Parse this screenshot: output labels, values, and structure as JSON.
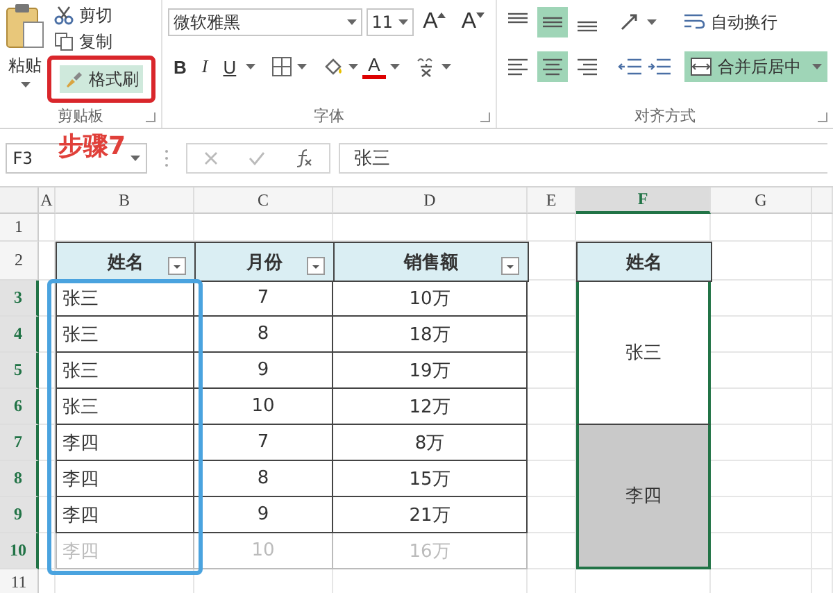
{
  "ribbon": {
    "clipboard": {
      "paste": "粘贴",
      "cut": "剪切",
      "copy": "复制",
      "format_painter": {
        "label": "格式刷",
        "selected": true
      },
      "label": "剪贴板"
    },
    "font": {
      "font_name": "微软雅黑",
      "font_size": "11",
      "bold": "B",
      "italic": "I",
      "underline": "U",
      "font_color": "A",
      "grow": "A",
      "shrink": "A",
      "label": "字体"
    },
    "alignment": {
      "vertical": [
        {
          "kind": "top",
          "selected": false
        },
        {
          "kind": "middle",
          "selected": true
        },
        {
          "kind": "bottom",
          "selected": false
        }
      ],
      "horizontal": [
        {
          "kind": "left",
          "selected": false
        },
        {
          "kind": "center",
          "selected": true
        },
        {
          "kind": "right",
          "selected": false
        }
      ],
      "wrap_text": "自动换行",
      "merge": {
        "label": "合并后居中",
        "selected": true
      },
      "label": "对齐方式"
    }
  },
  "annotation": "步骤7",
  "formula_bar": {
    "name_box": "F3",
    "value": "张三"
  },
  "columns": [
    {
      "label": "A",
      "selected": false
    },
    {
      "label": "B",
      "selected": false
    },
    {
      "label": "C",
      "selected": false
    },
    {
      "label": "D",
      "selected": false
    },
    {
      "label": "E",
      "selected": false
    },
    {
      "label": "F",
      "selected": true
    },
    {
      "label": "G",
      "selected": false
    }
  ],
  "row_numbers": [
    {
      "label": "1",
      "selected": false
    },
    {
      "label": "2",
      "selected": false
    },
    {
      "label": "3",
      "selected": true
    },
    {
      "label": "4",
      "selected": true
    },
    {
      "label": "5",
      "selected": true
    },
    {
      "label": "6",
      "selected": true
    },
    {
      "label": "7",
      "selected": true
    },
    {
      "label": "8",
      "selected": true
    },
    {
      "label": "9",
      "selected": true
    },
    {
      "label": "10",
      "selected": true
    },
    {
      "label": "11",
      "selected": false
    }
  ],
  "table": {
    "columns": [
      "姓名",
      "月份",
      "销售额"
    ],
    "rows": [
      {
        "cells": [
          "张三",
          "7",
          "10万"
        ],
        "faded": false
      },
      {
        "cells": [
          "张三",
          "8",
          "18万"
        ],
        "faded": false
      },
      {
        "cells": [
          "张三",
          "9",
          "19万"
        ],
        "faded": false
      },
      {
        "cells": [
          "张三",
          "10",
          "12万"
        ],
        "faded": false
      },
      {
        "cells": [
          "李四",
          "7",
          "8万"
        ],
        "faded": false
      },
      {
        "cells": [
          "李四",
          "8",
          "15万"
        ],
        "faded": false
      },
      {
        "cells": [
          "李四",
          "9",
          "21万"
        ],
        "faded": false
      },
      {
        "cells": [
          "李四",
          "10",
          "16万"
        ],
        "faded": true
      }
    ]
  },
  "merged": {
    "header": "姓名",
    "groups": [
      {
        "name": "张三",
        "shaded": false
      },
      {
        "name": "李四",
        "shaded": true
      }
    ]
  }
}
